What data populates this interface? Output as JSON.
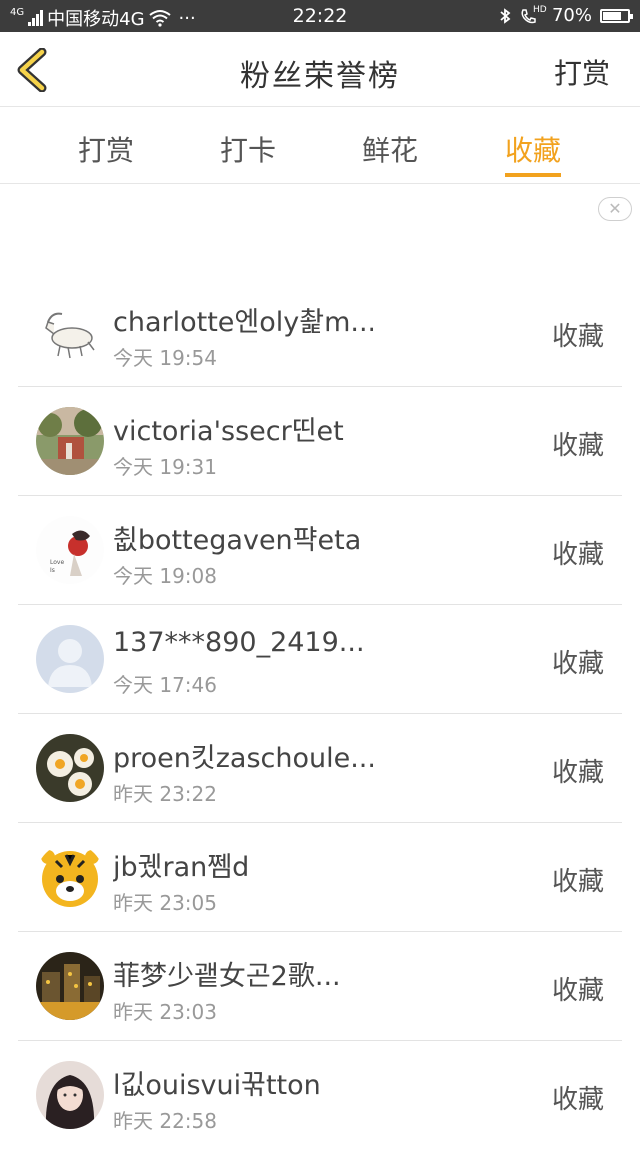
{
  "status_bar": {
    "carrier": "中国移动4G",
    "network_tag": "4G",
    "dots": "···",
    "time": "22:22",
    "hd": "HD",
    "battery": "70%"
  },
  "nav": {
    "title": "粉丝荣誉榜",
    "right_action": "打赏"
  },
  "tabs": [
    {
      "label": "打赏",
      "active": false
    },
    {
      "label": "打卡",
      "active": false
    },
    {
      "label": "鲜花",
      "active": false
    },
    {
      "label": "收藏",
      "active": true
    }
  ],
  "ad_close": "✕",
  "list": [
    {
      "name": "charlotte엔oly촱m...",
      "time": "今天 19:54",
      "action": "收藏",
      "avatar": "goat"
    },
    {
      "name": "victoria'ssecr띤et",
      "time": "今天 19:31",
      "action": "收藏",
      "avatar": "garden"
    },
    {
      "name": "췺bottegaven퍅eta",
      "time": "今天 19:08",
      "action": "收藏",
      "avatar": "illustration"
    },
    {
      "name": "137***890_2419...",
      "time": "今天 17:46",
      "action": "收藏",
      "avatar": "default-user"
    },
    {
      "name": "proen킷zaschoule...",
      "time": "昨天 23:22",
      "action": "收藏",
      "avatar": "flowers"
    },
    {
      "name": "jb궸ran쩸d",
      "time": "昨天 23:05",
      "action": "收藏",
      "avatar": "tiger"
    },
    {
      "name": "菲梦少괱女곤2歌...",
      "time": "昨天 23:03",
      "action": "收藏",
      "avatar": "city-night"
    },
    {
      "name": "l깂ouisvui꾺tton",
      "time": "昨天 22:58",
      "action": "收藏",
      "avatar": "girl"
    }
  ],
  "colors": {
    "accent": "#f2a21e",
    "status_bar": "#3c3c3c",
    "divider": "#e3e3e3"
  }
}
